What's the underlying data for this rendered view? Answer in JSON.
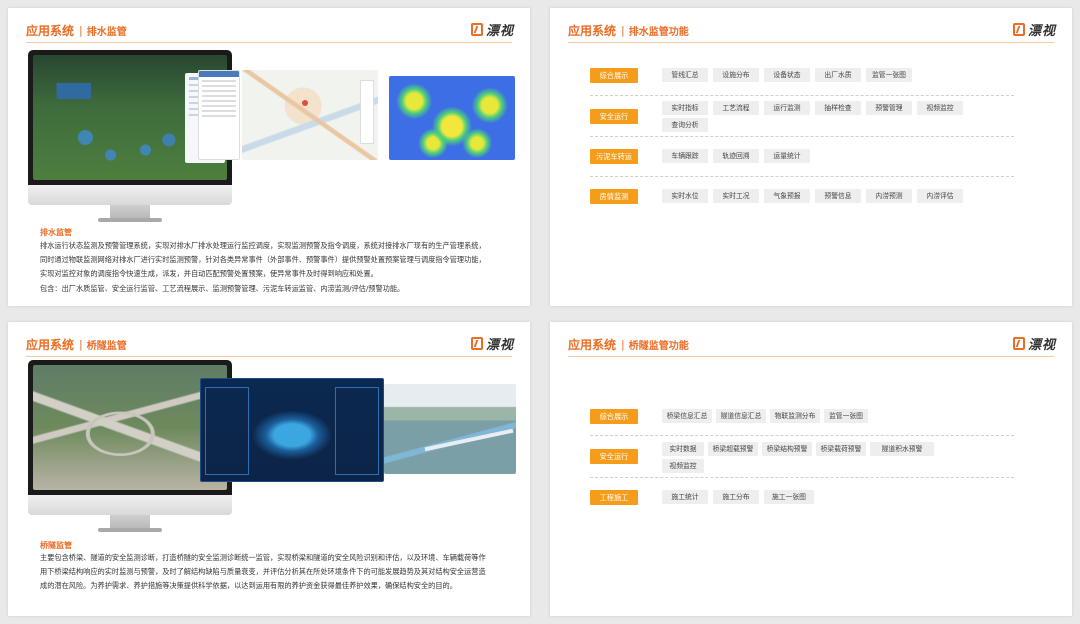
{
  "brand": {
    "logo_text": "漂视"
  },
  "slide1": {
    "section_title": "应用系统",
    "sub_title": "排水监管",
    "desc_title": "排水监管",
    "paragraphs": [
      "排水运行状态监测及预警管理系统，实现对排水厂排水处理运行监控调度，实现监测预警及指令调度，系统对接排水厂现有的生产管理系统，",
      "同时通过物联监测网络对排水厂进行实时监测预警，针对各类异常事件（外部事件、预警事件）提供预警处置预案管理与调度指令管理功能，",
      "实现对监控对象的调度指令快速生成，派发，并自动匹配预警处置预案，使异常事件及时得到响应和处置。",
      "包含：出厂水质监管、安全运行监管、工艺流程展示、监测预警管理、污泥车转运监管、内涝监测/评估/预警功能。"
    ]
  },
  "slide2": {
    "section_title": "应用系统",
    "sub_title": "排水监管功能",
    "rows": [
      {
        "category": "综合展示",
        "items": [
          "管线汇总",
          "设施分布",
          "设备状态",
          "出厂水质",
          "监管一张图"
        ]
      },
      {
        "category": "安全运行",
        "items": [
          "实时指标",
          "工艺流程",
          "运行监测",
          "抽样检查",
          "预警管理",
          "视频监控",
          "查询分析"
        ]
      },
      {
        "category": "污泥车转运",
        "items": [
          "车辆跟踪",
          "轨迹回溯",
          "运量统计"
        ]
      },
      {
        "category": "房情监测",
        "items": [
          "实时水位",
          "实时工况",
          "气象预报",
          "预警信息",
          "内涝预测",
          "内涝评估"
        ]
      }
    ]
  },
  "slide3": {
    "section_title": "应用系统",
    "sub_title": "桥隧监管",
    "desc_title": "桥隧监管",
    "paragraphs": [
      "主要包含桥梁、隧道的安全监测诊断，打造桥隧的安全监测诊断统一监管，实现桥梁和隧道的安全风险识别和评估，以及环境、车辆载荷等作",
      "用下桥梁结构响应的实时监测与预警，及时了解结构缺陷与质量衰变，并评估分析其在所处环境条件下的可能发展趋势及其对结构安全运营造",
      "成的潜在风险。为养护需求、养护措施等决策提供科学依据，以达到运用有限的养护资金获得最佳养护效果，确保结构安全的目的。"
    ]
  },
  "slide4": {
    "section_title": "应用系统",
    "sub_title": "桥隧监管功能",
    "rows": [
      {
        "category": "综合展示",
        "items": [
          "桥梁信息汇总",
          "隧道信息汇总",
          "物联监测分布",
          "监管一张图"
        ]
      },
      {
        "category": "安全运行",
        "items": [
          "实时数据",
          "桥梁超载预警",
          "桥梁结构预警",
          "桥梁载荷预警",
          "隧道积水预警",
          "视频监控"
        ]
      },
      {
        "category": "工程施工",
        "items": [
          "施工统计",
          "施工分布",
          "施工一张图"
        ]
      }
    ]
  },
  "colors": {
    "accent": "#ea6d26",
    "category_bg": "#f59d1a",
    "chip_bg": "#eeeeee"
  },
  "icons": [
    "logo-mark-icon",
    "monitor-icon"
  ]
}
